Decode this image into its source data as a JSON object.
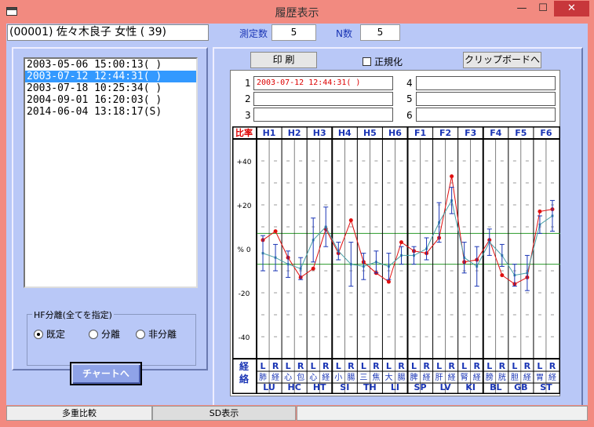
{
  "window": {
    "title": "履歴表示",
    "minimize": "—",
    "maximize": "☐",
    "close": "✕",
    "close_color": "#c7373b"
  },
  "header": {
    "patient": "(00001) 佐々木良子 女性 ( 39)",
    "measure_label": "測定数",
    "measure_value": "5",
    "n_label": "N数",
    "n_value": "5"
  },
  "history": {
    "items": [
      "2003-05-06  15:00:13( )",
      "2003-07-12  12:44:31( )",
      "2003-07-18  10:25:34( )",
      "2004-09-01  16:20:03( )",
      "2014-06-04  13:18:17(S)"
    ],
    "selected": 1
  },
  "hf": {
    "title": "HF分離(全てを指定)",
    "options": [
      "既定",
      "分離",
      "非分離"
    ],
    "selected": 0
  },
  "buttons": {
    "chart": "チャートへ",
    "print": "印 刷",
    "normalize": "正規化",
    "clipboard": "クリップボードへ"
  },
  "slots": [
    {
      "num": "1",
      "text": "2003-07-12 12:44:31( )"
    },
    {
      "num": "2",
      "text": ""
    },
    {
      "num": "3",
      "text": ""
    },
    {
      "num": "4",
      "text": ""
    },
    {
      "num": "5",
      "text": ""
    },
    {
      "num": "6",
      "text": ""
    }
  ],
  "statusbar": {
    "tab1": "多重比較",
    "tab2": "SD表示"
  },
  "chart_data": {
    "type": "line",
    "corner_label": "比率",
    "left_label": "経絡",
    "ylim": [
      -50,
      50
    ],
    "yticks": [
      "+40",
      "+20",
      "% 0",
      "-20",
      "-40"
    ],
    "groups": [
      "H1",
      "H2",
      "H3",
      "H4",
      "H5",
      "H6",
      "F1",
      "F2",
      "F3",
      "F4",
      "F5",
      "F6"
    ],
    "organs": [
      "肺",
      "経",
      "心",
      "包",
      "心",
      "経",
      "小",
      "腸",
      "三",
      "焦",
      "大",
      "腸",
      "脾",
      "経",
      "肝",
      "経",
      "腎",
      "経",
      "膀",
      "胱",
      "胆",
      "経",
      "胃",
      "経"
    ],
    "codes": [
      "LU",
      "HC",
      "HT",
      "SI",
      "TH",
      "LI",
      "SP",
      "LV",
      "KI",
      "BL",
      "GB",
      "ST"
    ],
    "side_labels": [
      "L",
      "R"
    ],
    "series": [
      {
        "name": "",
        "color": "#e01010",
        "values": [
          4,
          8,
          -4,
          -13,
          -9,
          9,
          -2,
          13,
          -6,
          -11,
          -15,
          3,
          -1,
          -2,
          5,
          33,
          -6,
          -5,
          4,
          -12,
          -16,
          -13,
          17,
          18
        ]
      },
      {
        "name": "",
        "color": "#4aa0a8",
        "values": [
          -2,
          -4,
          -7,
          -9,
          4,
          10,
          -1,
          -7,
          -8,
          -6,
          -8,
          -3,
          -3,
          0,
          12,
          22,
          -4,
          -8,
          3,
          -3,
          -12,
          -11,
          11,
          15
        ]
      }
    ],
    "errors": [
      8,
      6,
      6,
      5,
      10,
      9,
      4,
      10,
      6,
      5,
      6,
      4,
      4,
      5,
      9,
      6,
      7,
      9,
      6,
      5,
      5,
      8,
      4,
      7
    ],
    "green_band": [
      7,
      -7
    ]
  }
}
